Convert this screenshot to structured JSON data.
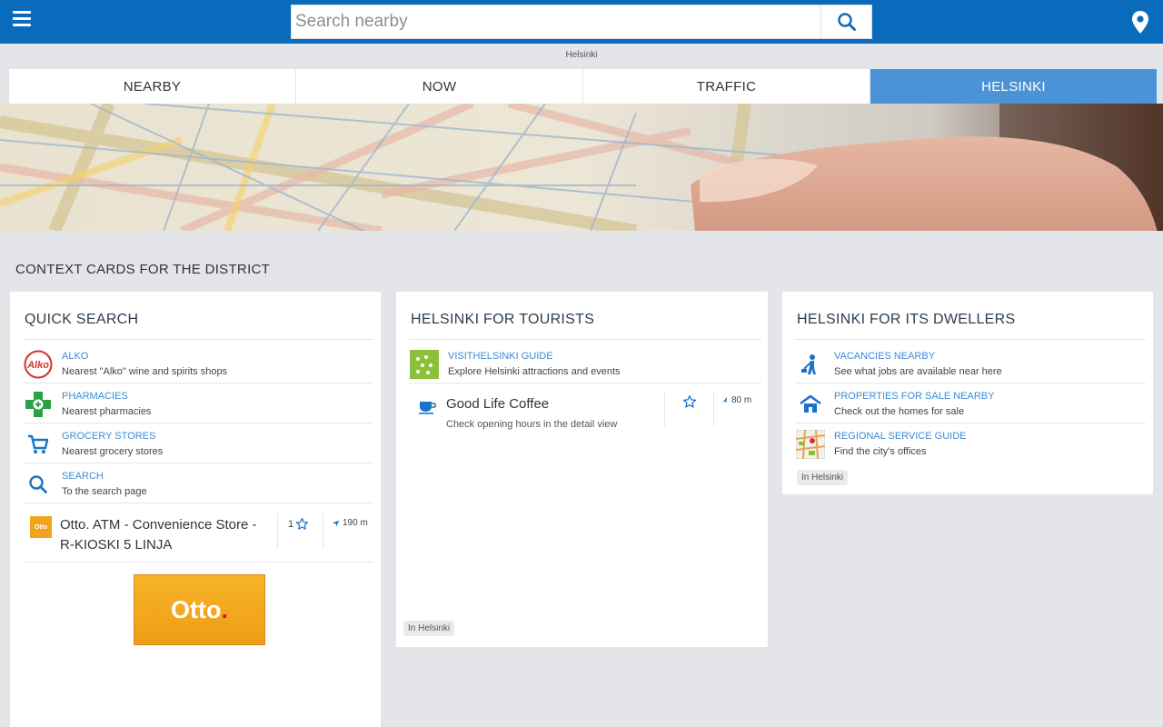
{
  "header": {
    "search_placeholder": "Search nearby",
    "menu_icon": "hamburger-menu-icon",
    "search_icon": "search-icon",
    "location_icon": "location-pin-icon",
    "accent_color": "#0a6bbd"
  },
  "location_label": "Helsinki",
  "tabs": [
    {
      "label": "NEARBY",
      "active": false
    },
    {
      "label": "NOW",
      "active": false
    },
    {
      "label": "TRAFFIC",
      "active": false
    },
    {
      "label": "HELSINKI",
      "active": true
    }
  ],
  "section_title": "CONTEXT CARDS FOR THE DISTRICT",
  "cards": {
    "quick_search": {
      "title": "QUICK SEARCH",
      "items": [
        {
          "title": "ALKO",
          "subtitle": "Nearest \"Alko\" wine and spirits shops",
          "icon": "alko-logo-icon"
        },
        {
          "title": "PHARMACIES",
          "subtitle": "Nearest pharmacies",
          "icon": "pharmacy-icon"
        },
        {
          "title": "GROCERY STORES",
          "subtitle": "Nearest grocery stores",
          "icon": "shopping-cart-icon"
        },
        {
          "title": "SEARCH",
          "subtitle": "To the search page",
          "icon": "search-icon"
        }
      ],
      "place": {
        "name": "Otto. ATM - Convenience Store - R-KIOSKI 5 LINJA",
        "icon_text": "Otto",
        "favorites": "1",
        "distance": "190 m"
      },
      "banner_text": "Otto",
      "banner_dot": "."
    },
    "tourists": {
      "title": "HELSINKI FOR TOURISTS",
      "items": [
        {
          "title": "VISITHELSINKI GUIDE",
          "subtitle": "Explore Helsinki attractions and events",
          "icon": "visithelsinki-icon"
        }
      ],
      "place": {
        "name": "Good Life Coffee",
        "subtitle": "Check opening hours in the detail view",
        "icon": "coffee-cup-icon",
        "distance": "80 m"
      },
      "badge": "In Helsinki"
    },
    "dwellers": {
      "title": "HELSINKI FOR ITS DWELLERS",
      "items": [
        {
          "title": "VACANCIES NEARBY",
          "subtitle": "See what jobs are available near here",
          "icon": "worker-icon"
        },
        {
          "title": "PROPERTIES FOR SALE NEARBY",
          "subtitle": "Check out the homes for sale",
          "icon": "house-icon"
        },
        {
          "title": "REGIONAL SERVICE GUIDE",
          "subtitle": "Find the city's offices",
          "icon": "map-guide-icon"
        }
      ],
      "badge": "In Helsinki"
    }
  }
}
